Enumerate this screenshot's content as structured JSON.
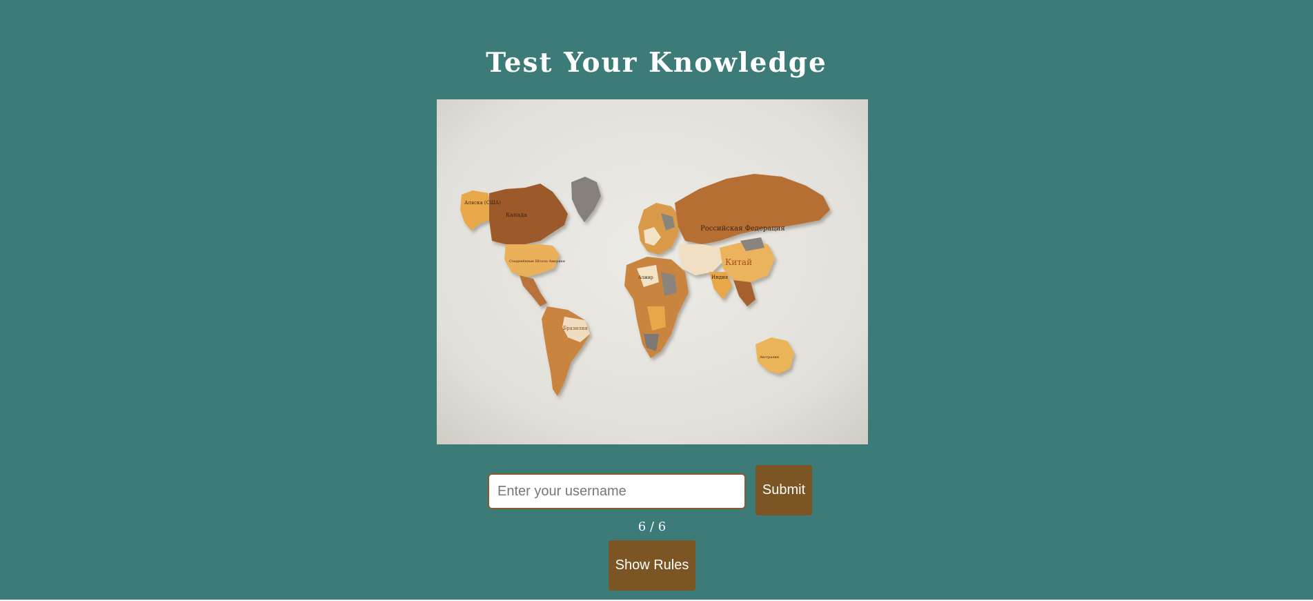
{
  "page": {
    "title": "Test Your Knowledge"
  },
  "quiz_image": {
    "description_icon": "world-map-image",
    "labels": {
      "alaska": "Аляска (США)",
      "canada": "Канада",
      "usa": "Соединённые Штаты Америки",
      "russia": "Российская Федерация",
      "china": "Китай",
      "india": "Индия",
      "brazil": "Бразилия",
      "australia": "Австралия",
      "algeria": "Алжир"
    }
  },
  "form": {
    "username_placeholder": "Enter your username",
    "username_value": "",
    "submit_label": "Submit"
  },
  "progress": {
    "counter_text": "6 / 6"
  },
  "rules": {
    "button_label": "Show Rules"
  },
  "colors": {
    "background": "#3c7b78",
    "button": "#7b5523",
    "input_border": "#8b5a2b"
  }
}
